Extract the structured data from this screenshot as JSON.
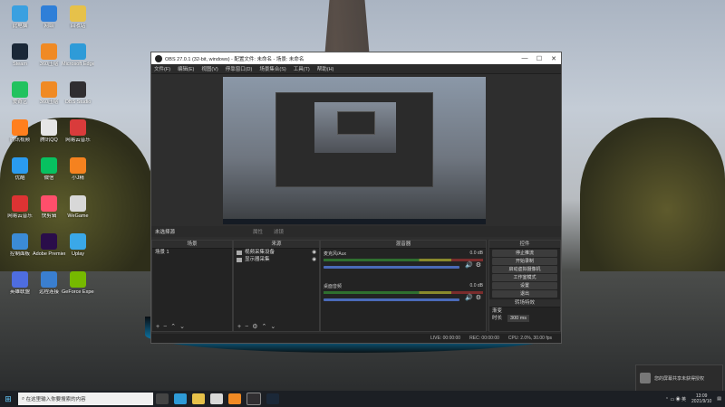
{
  "desktop": {
    "icons": [
      {
        "label": "此电脑",
        "color": "#3aa0e0"
      },
      {
        "label": "网络",
        "color": "#2f7fd8"
      },
      {
        "label": "回收站",
        "color": "#e6c14a"
      },
      {
        "label": "Steam",
        "color": "#1b2838"
      },
      {
        "label": "360压缩",
        "color": "#f08a24"
      },
      {
        "label": "Microsoft Edge",
        "color": "#2e9bd8"
      },
      {
        "label": "爱奇艺",
        "color": "#21c25e"
      },
      {
        "label": "360压缩",
        "color": "#f08a24"
      },
      {
        "label": "OBS Studio",
        "color": "#302e31"
      },
      {
        "label": "腾讯视频",
        "color": "#ff7f1e"
      },
      {
        "label": "腾讯QQ",
        "color": "#e5e5e5"
      },
      {
        "label": "网易云音乐",
        "color": "#d93b3b"
      },
      {
        "label": "优酷",
        "color": "#2a9bf0"
      },
      {
        "label": "微信",
        "color": "#07c160"
      },
      {
        "label": "小J精",
        "color": "#f5821f"
      },
      {
        "label": "网易云音乐",
        "color": "#d33"
      },
      {
        "label": "快剪辑",
        "color": "#ff4f6b"
      },
      {
        "label": "WeGame",
        "color": "#d8d8d8"
      },
      {
        "label": "控制面板",
        "color": "#3b8bd6"
      },
      {
        "label": "Adobe Premiere",
        "color": "#2a0d4a"
      },
      {
        "label": "Uplay",
        "color": "#3aa8e8"
      },
      {
        "label": "英雄联盟",
        "color": "#4e6de0"
      },
      {
        "label": "远程连接",
        "color": "#3a7fd0"
      },
      {
        "label": "GeForce Experience",
        "color": "#76b900"
      }
    ]
  },
  "obs": {
    "title": "OBS 27.0.1 (32-bit, windows) - 配置文件: 未命名 - 场景: 未命名",
    "window_buttons": [
      "—",
      "☐",
      "✕"
    ],
    "menu": [
      "文件(F)",
      "编辑(E)",
      "视图(V)",
      "停靠窗口(D)",
      "场景集合(S)",
      "工具(T)",
      "帮助(H)"
    ],
    "status_strip": {
      "label": "未选择源",
      "props": "属性",
      "filters": "滤镜"
    },
    "docks": {
      "scenes": {
        "title": "场景",
        "items": [
          "场景 1"
        ]
      },
      "sources": {
        "title": "来源",
        "items": [
          "视频采集设备",
          "显示器采集"
        ]
      },
      "mixer": {
        "title": "混音器",
        "channels": [
          {
            "name": "麦克风/Aux",
            "db": "0.0 dB"
          },
          {
            "name": "桌面音频",
            "db": "0.0 dB"
          }
        ]
      },
      "controls": {
        "title": "控件",
        "buttons": [
          "停止推流",
          "开始录制",
          "启动虚拟摄像机",
          "工作室模式",
          "设置",
          "退出"
        ]
      },
      "transitions": {
        "title": "转场特效",
        "type": "渐变",
        "duration_label": "时长",
        "duration": "300 ms"
      }
    },
    "statusbar": {
      "live": "LIVE: 00:00:00",
      "rec": "REC: 00:00:00",
      "cpu": "CPU: 2.0%, 30.00 fps"
    }
  },
  "taskbar": {
    "search_placeholder": "在这里输入你要搜索的内容",
    "time": "13:09",
    "date": "2021/9/10"
  },
  "toast": {
    "text": "您的屏幕共享未获得授权"
  }
}
